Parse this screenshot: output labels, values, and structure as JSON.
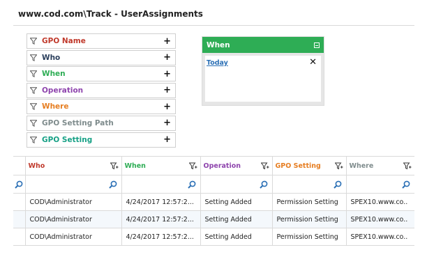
{
  "page": {
    "title": "www.cod.com\\Track - UserAssignments"
  },
  "filters": [
    {
      "label": "GPO Name",
      "color": "#c0392b"
    },
    {
      "label": "Who",
      "color": "#2b3f5c"
    },
    {
      "label": "When",
      "color": "#2ead55"
    },
    {
      "label": "Operation",
      "color": "#8e44ad"
    },
    {
      "label": "Where",
      "color": "#e67e22"
    },
    {
      "label": "GPO Setting Path",
      "color": "#7f8c8d"
    },
    {
      "label": "GPO Setting",
      "color": "#16a085"
    }
  ],
  "when_panel": {
    "title": "When",
    "header_color": "#2ead55",
    "link": "Today",
    "close_icon": "close-icon",
    "collapse_icon": "collapse-icon"
  },
  "grid": {
    "columns": [
      {
        "label": "Who",
        "color": "#c0392b"
      },
      {
        "label": "When",
        "color": "#2ead55"
      },
      {
        "label": "Operation",
        "color": "#8e44ad"
      },
      {
        "label": "GPO Setting",
        "color": "#e67e22"
      },
      {
        "label": "Where",
        "color": "#7f8c8d"
      }
    ],
    "rows": [
      [
        "COD\\Administrator",
        "4/24/2017 12:57:2...",
        "Setting Added",
        "Permission Setting",
        "SPEX10.www.co.."
      ],
      [
        "COD\\Administrator",
        "4/24/2017 12:57:2...",
        "Setting Added",
        "Permission Setting",
        "SPEX10.www.co.."
      ],
      [
        "COD\\Administrator",
        "4/24/2017 12:57:2...",
        "Setting Added",
        "Permission Setting",
        "SPEX10.www.co.."
      ]
    ]
  },
  "icons": {
    "filter": "filter-icon",
    "search": "search-icon",
    "plus": "plus-icon"
  },
  "accent": "#2a6fb5"
}
